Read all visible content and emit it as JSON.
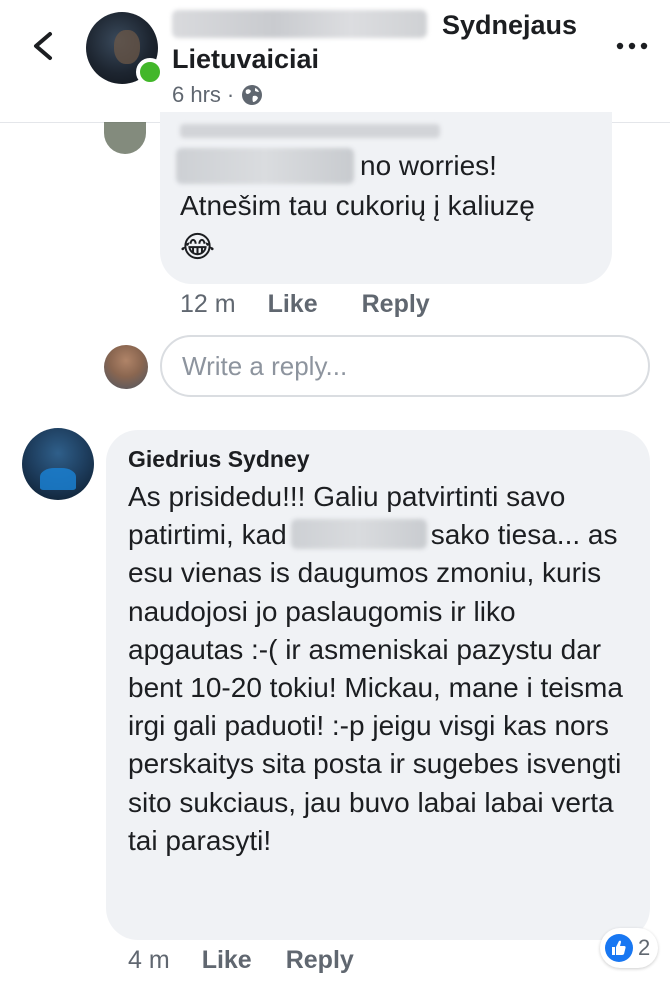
{
  "header": {
    "group_line1": "Sydnejaus",
    "group_line2": "Lietuvaiciai",
    "timestamp": "6 hrs",
    "separator": "·",
    "back_icon": "chevron-left-icon",
    "more_icon": "ellipsis-icon",
    "privacy_icon": "globe-icon"
  },
  "comment1": {
    "text_line1": "no worries!",
    "text_line2": "Atnešim tau cukorių į kaliuzę",
    "emoji": "😂",
    "time": "12 m",
    "like_label": "Like",
    "reply_label": "Reply"
  },
  "reply_box": {
    "placeholder": "Write a reply..."
  },
  "comment2": {
    "author": "Giedrius Sydney",
    "text_before": "As prisidedu!!! Galiu patvirtinti savo patirtimi, kad",
    "text_after": "sako tiesa... as esu vienas is daugumos zmoniu, kuris naudojosi jo paslaugomis ir liko apgautas :-( ir asmeniskai pazystu dar bent 10-20 tokiu! Mickau, mane i teisma irgi gali paduoti! :-p jeigu visgi kas nors perskaitys sita posta ir sugebes isvengti sito sukciaus, jau buvo labai labai verta tai parasyti!",
    "time": "4 m",
    "like_label": "Like",
    "reply_label": "Reply",
    "reaction_count": "2",
    "reaction_icon": "thumbs-up-icon"
  },
  "colors": {
    "bubble": "#f0f2f5",
    "text": "#1c1e21",
    "muted": "#606770",
    "like_blue": "#1877f2",
    "online_green": "#42b72a"
  }
}
